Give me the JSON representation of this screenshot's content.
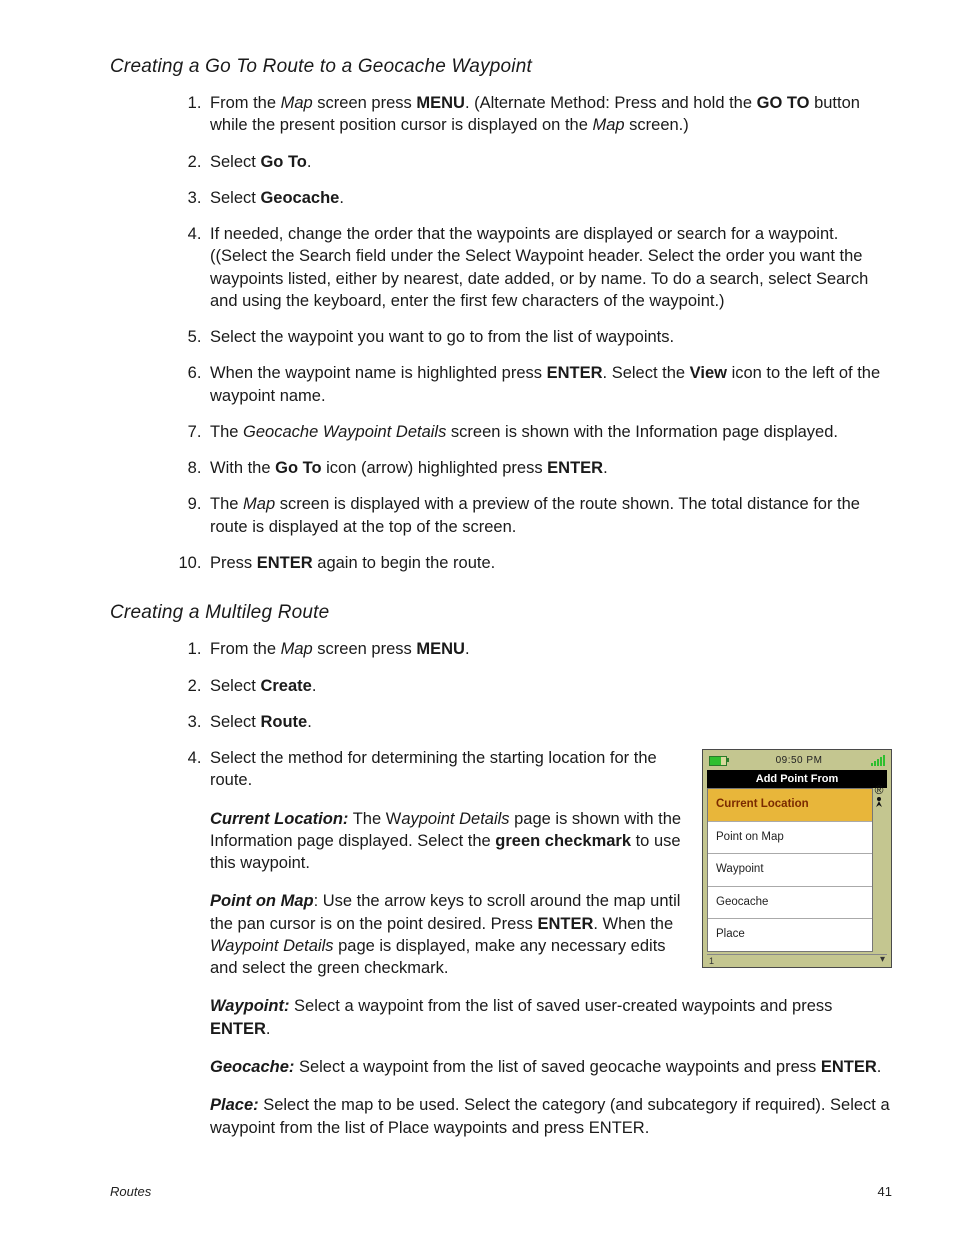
{
  "section1": {
    "heading": "Creating a Go To Route to a Geocache Waypoint",
    "steps": {
      "s1a": "From the ",
      "s1b": "Map",
      "s1c": " screen press ",
      "s1d": "MENU",
      "s1e": ".  (Alternate Method:  Press and hold the ",
      "s1f": "GO TO",
      "s1g": " button while the present position cursor is displayed on the ",
      "s1h": "Map",
      "s1i": " screen.)",
      "s2a": "Select ",
      "s2b": "Go To",
      "s2c": ".",
      "s3a": "Select ",
      "s3b": "Geocache",
      "s3c": ".",
      "s4": "If needed, change the order that the waypoints are displayed or search for a waypoint.  ((Select the Search field under the Select Waypoint header.  Select the order you want the waypoints listed, either by nearest, date added, or by name.  To do a search, select Search and using the keyboard, enter the first few characters of the waypoint.)",
      "s5": "Select the waypoint you want to go to from the list of waypoints.",
      "s6a": "When the waypoint name is highlighted press ",
      "s6b": "ENTER",
      "s6c": ".  Select the ",
      "s6d": "View",
      "s6e": " icon to the left of the waypoint name.",
      "s7a": "The ",
      "s7b": "Geocache Waypoint Details",
      "s7c": " screen is shown with the Information page displayed.",
      "s8a": "With the ",
      "s8b": "Go To",
      "s8c": " icon (arrow) highlighted press ",
      "s8d": "ENTER",
      "s8e": ".",
      "s9a": "The ",
      "s9b": "Map",
      "s9c": " screen is displayed with a preview of the route shown.  The total distance for the route is displayed at the top of the screen.",
      "s10a": "Press ",
      "s10b": "ENTER",
      "s10c": " again to begin the route."
    }
  },
  "section2": {
    "heading": "Creating a Multileg Route",
    "steps": {
      "s1a": "From the ",
      "s1b": "Map",
      "s1c": " screen press ",
      "s1d": "MENU",
      "s1e": ".",
      "s2a": "Select ",
      "s2b": "Create",
      "s2c": ".",
      "s3a": "Select ",
      "s3b": "Route",
      "s3c": ".",
      "s4": "Select the method for determining the starting location for the route."
    },
    "subs": {
      "cl_label": "Current Location:",
      "cl_a": "  The W",
      "cl_b": "aypoint Details",
      "cl_c": " page is shown with the Information page displayed.  Select the ",
      "cl_d": "green checkmark",
      "cl_e": " to use this waypoint.",
      "pom_label": "Point on Map",
      "pom_a": ":  Use the arrow keys to scroll around the map until the pan cursor is on the point desired.  Press ",
      "pom_b": "ENTER",
      "pom_c": ".  When the ",
      "pom_d": "Waypoint Details",
      "pom_e": " page is displayed, make any necessary edits and select the green checkmark.",
      "wp_label": "Waypoint:",
      "wp_a": "  Select a waypoint from the list of saved user-created waypoints and press ",
      "wp_b": "ENTER",
      "wp_c": ".",
      "gc_label": "Geocache:",
      "gc_a": " Select a waypoint from the list of saved geocache waypoints and press ",
      "gc_b": "ENTER",
      "gc_c": ".",
      "pl_label": "Place:",
      "pl_a": "   Select the map to be used.  Select the category (and subcategory if required).  Select a waypoint from the list of Place waypoints and press ENTER."
    }
  },
  "device": {
    "time": "09:50 PM",
    "title": "Add Point From",
    "items": [
      "Current Location",
      "Point on Map",
      "Waypoint",
      "Geocache",
      "Place"
    ],
    "tick": "1",
    "reg": "®"
  },
  "footer": {
    "label": "Routes",
    "page": "41"
  }
}
